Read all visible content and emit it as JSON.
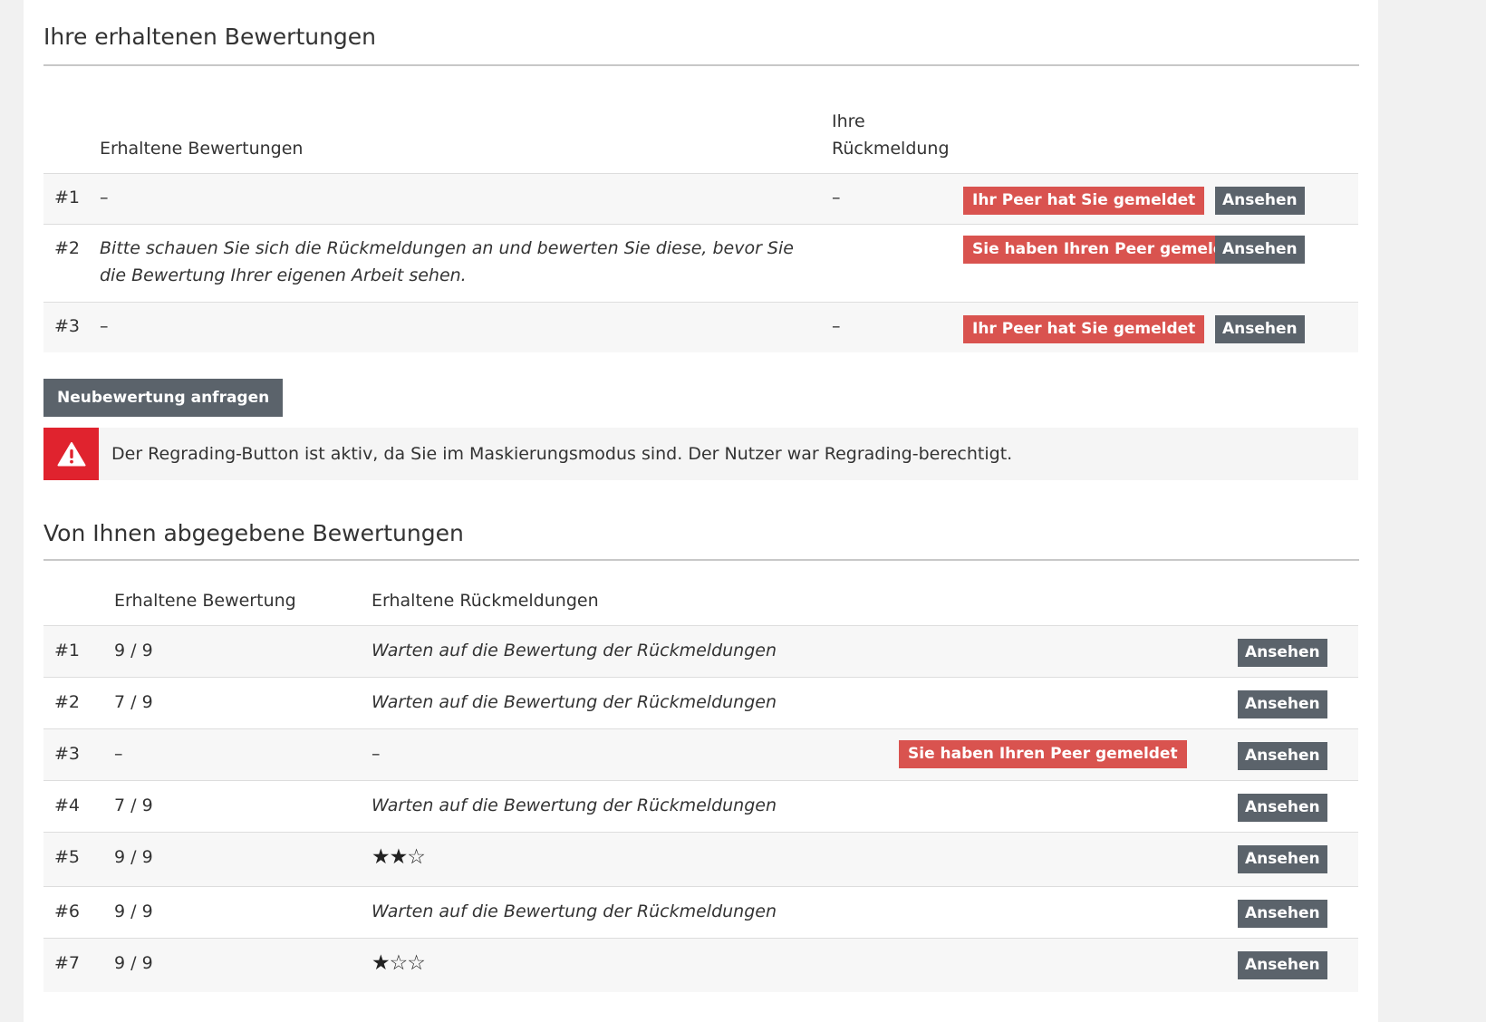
{
  "received": {
    "title": "Ihre erhaltenen Bewertungen",
    "headers": {
      "col_reviews": "Erhaltene Bewertungen",
      "col_feedback_line1": "Ihre",
      "col_feedback_line2": "Rückmeldung"
    },
    "rows": [
      {
        "num": "#1",
        "review": "–",
        "feedback": "–",
        "badge": "Ihr Peer hat Sie gemeldet",
        "action": "Ansehen"
      },
      {
        "num": "#2",
        "review": "Bitte schauen Sie sich die Rückmeldungen an und bewerten Sie diese, bevor Sie die Bewertung Ihrer eigenen Arbeit sehen.",
        "feedback": "",
        "badge": "Sie haben Ihren Peer gemeldet",
        "action": "Ansehen"
      },
      {
        "num": "#3",
        "review": "–",
        "feedback": "–",
        "badge": "Ihr Peer hat Sie gemeldet",
        "action": "Ansehen"
      }
    ],
    "regrade_button": "Neubewertung anfragen",
    "alert": {
      "icon": "warning-triangle-icon",
      "text": "Der Regrading-Button ist aktiv, da Sie im Maskierungsmodus sind. Der Nutzer war Regrading-berechtigt."
    }
  },
  "given": {
    "title": "Von Ihnen abgegebene Bewertungen",
    "headers": {
      "col_grade": "Erhaltene Bewertung",
      "col_feedback": "Erhaltene Rückmeldungen"
    },
    "rows": [
      {
        "num": "#1",
        "grade": "9 / 9",
        "feedback": "Warten auf die Bewertung der Rückmeldungen",
        "badge": "",
        "action": "Ansehen"
      },
      {
        "num": "#2",
        "grade": "7 / 9",
        "feedback": "Warten auf die Bewertung der Rückmeldungen",
        "badge": "",
        "action": "Ansehen"
      },
      {
        "num": "#3",
        "grade": "–",
        "feedback": "–",
        "badge": "Sie haben Ihren Peer gemeldet",
        "action": "Ansehen"
      },
      {
        "num": "#4",
        "grade": "7 / 9",
        "feedback": "Warten auf die Bewertung der Rückmeldungen",
        "badge": "",
        "action": "Ansehen"
      },
      {
        "num": "#5",
        "grade": "9 / 9",
        "stars": "★★☆",
        "star_rating": 2,
        "badge": "",
        "action": "Ansehen"
      },
      {
        "num": "#6",
        "grade": "9 / 9",
        "feedback": "Warten auf die Bewertung der Rückmeldungen",
        "badge": "",
        "action": "Ansehen"
      },
      {
        "num": "#7",
        "grade": "9 / 9",
        "stars": "★☆☆",
        "star_rating": 1,
        "badge": "",
        "action": "Ansehen"
      }
    ]
  },
  "colors": {
    "badge": "#d9534f",
    "button": "#5b636b",
    "alert_icon_bg": "#e0232e",
    "page_bg": "#f1f1f1"
  }
}
